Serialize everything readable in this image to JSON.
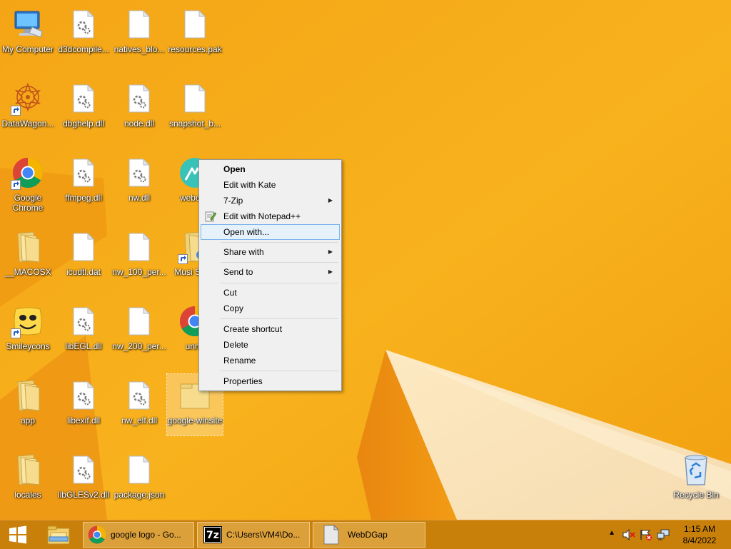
{
  "desktop": {
    "icons": [
      {
        "label": "My Computer",
        "icon": "my-computer-icon"
      },
      {
        "label": "d3dcompile...",
        "icon": "dll-file-icon"
      },
      {
        "label": "natives_blo...",
        "icon": "file-icon"
      },
      {
        "label": "resources.pak",
        "icon": "file-icon"
      },
      {
        "label": "DataWagon...",
        "icon": "datawagon-shortcut-icon"
      },
      {
        "label": "dbghelp.dll",
        "icon": "dll-file-icon"
      },
      {
        "label": "node.dll",
        "icon": "dll-file-icon"
      },
      {
        "label": "snapshot_b...",
        "icon": "file-icon"
      },
      {
        "label": "Google Chrome",
        "icon": "chrome-shortcut-icon"
      },
      {
        "label": "ffmpeg.dll",
        "icon": "dll-file-icon"
      },
      {
        "label": "nw.dll",
        "icon": "dll-file-icon"
      },
      {
        "label": "webdga",
        "icon": "webdgap-app-icon"
      },
      {
        "label": "__MACOSX",
        "icon": "folder-icon"
      },
      {
        "label": "icudtl.dat",
        "icon": "file-icon"
      },
      {
        "label": "nw_100_per...",
        "icon": "file-icon"
      },
      {
        "label": "Musi Short",
        "icon": "music-shortcut-icon"
      },
      {
        "label": "Smileycons",
        "icon": "smileycons-shortcut-icon"
      },
      {
        "label": "libEGL.dll",
        "icon": "dll-file-icon"
      },
      {
        "label": "nw_200_per...",
        "icon": "file-icon"
      },
      {
        "label": "unna",
        "icon": "chrome-shortcut-icon"
      },
      {
        "label": "app",
        "icon": "folder-icon"
      },
      {
        "label": "libexif.dll",
        "icon": "dll-file-icon"
      },
      {
        "label": "nw_elf.dll",
        "icon": "dll-file-icon"
      },
      {
        "label": "google-winsite",
        "icon": "folder-icon"
      },
      {
        "label": "locales",
        "icon": "folder-icon"
      },
      {
        "label": "libGLESv2.dll",
        "icon": "dll-file-icon"
      },
      {
        "label": "package.json",
        "icon": "file-icon"
      },
      {
        "label": "Recycle Bin",
        "icon": "recycle-bin-icon"
      }
    ]
  },
  "context_menu": {
    "items": [
      {
        "label": "Open"
      },
      {
        "label": "Edit with Kate"
      },
      {
        "label": "7-Zip"
      },
      {
        "label": "Edit with Notepad++"
      },
      {
        "label": "Open with..."
      },
      {
        "label": "Share with"
      },
      {
        "label": "Send to"
      },
      {
        "label": "Cut"
      },
      {
        "label": "Copy"
      },
      {
        "label": "Create shortcut"
      },
      {
        "label": "Delete"
      },
      {
        "label": "Rename"
      },
      {
        "label": "Properties"
      }
    ],
    "highlighted": "Open with..."
  },
  "taskbar": {
    "start_icon": "windows-start-icon",
    "pinned_icon": "file-explorer-icon",
    "buttons": [
      {
        "label": "google logo - Go...",
        "icon": "chrome-icon"
      },
      {
        "label": "C:\\Users\\VM4\\Do...",
        "icon": "7zip-icon"
      },
      {
        "label": "WebDGap",
        "icon": "webdgap-file-icon"
      }
    ],
    "tray": {
      "icons": [
        "show-hidden-icons-icon",
        "volume-muted-icon",
        "action-center-flag-icon",
        "network-icon"
      ],
      "time": "1:15 AM",
      "date": "8/4/2022"
    }
  },
  "colors": {
    "wallpaper": "#f5a614",
    "taskbar": "#c9800b",
    "menu_highlight": "#e5f1fb"
  }
}
